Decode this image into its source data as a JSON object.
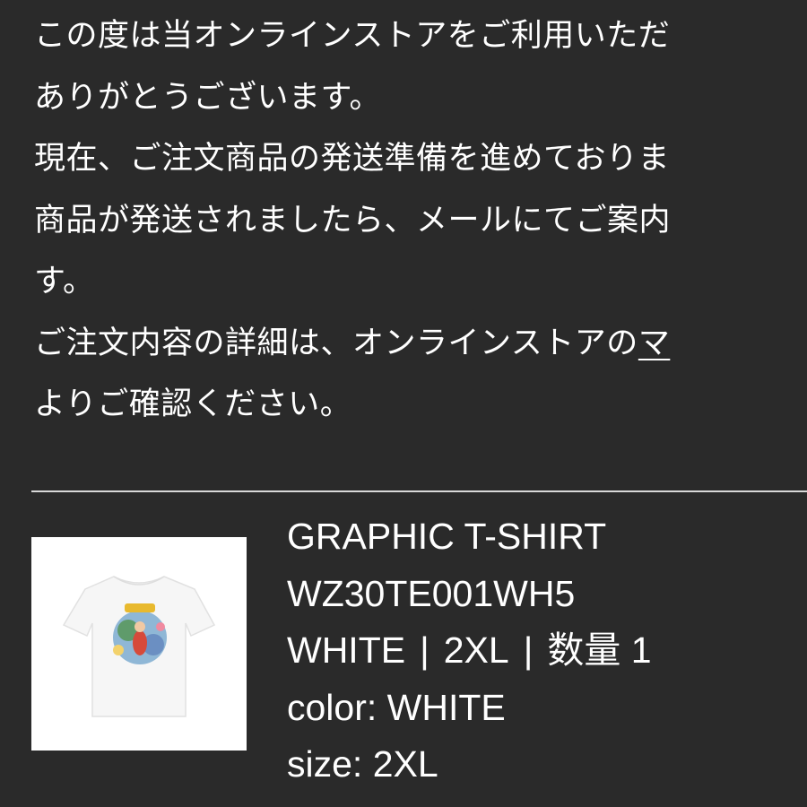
{
  "message": {
    "line1": "この度は当オンラインストアをご利用いただ",
    "line2": "ありがとうございます。",
    "line3": "現在、ご注文商品の発送準備を進めておりま",
    "line4": "商品が発送されましたら、メールにてご案内",
    "line5": "す。",
    "line6_prefix": "ご注文内容の詳細は、オンラインストアの",
    "line6_link": "マ",
    "line7": "よりご確認ください。"
  },
  "order_item": {
    "image_icon": "graphic-tshirt-thumbnail",
    "name": "GRAPHIC T-SHIRT",
    "sku": "WZ30TE001WH5",
    "variant_color": "WHITE",
    "variant_size": "2XL",
    "quantity_label": "数量 1",
    "separator": "|",
    "color_line": "color: WHITE",
    "size_line": "size: 2XL"
  },
  "colors": {
    "background": "#2a2a2a",
    "text": "#ffffff",
    "divider": "#d8d8d8"
  }
}
